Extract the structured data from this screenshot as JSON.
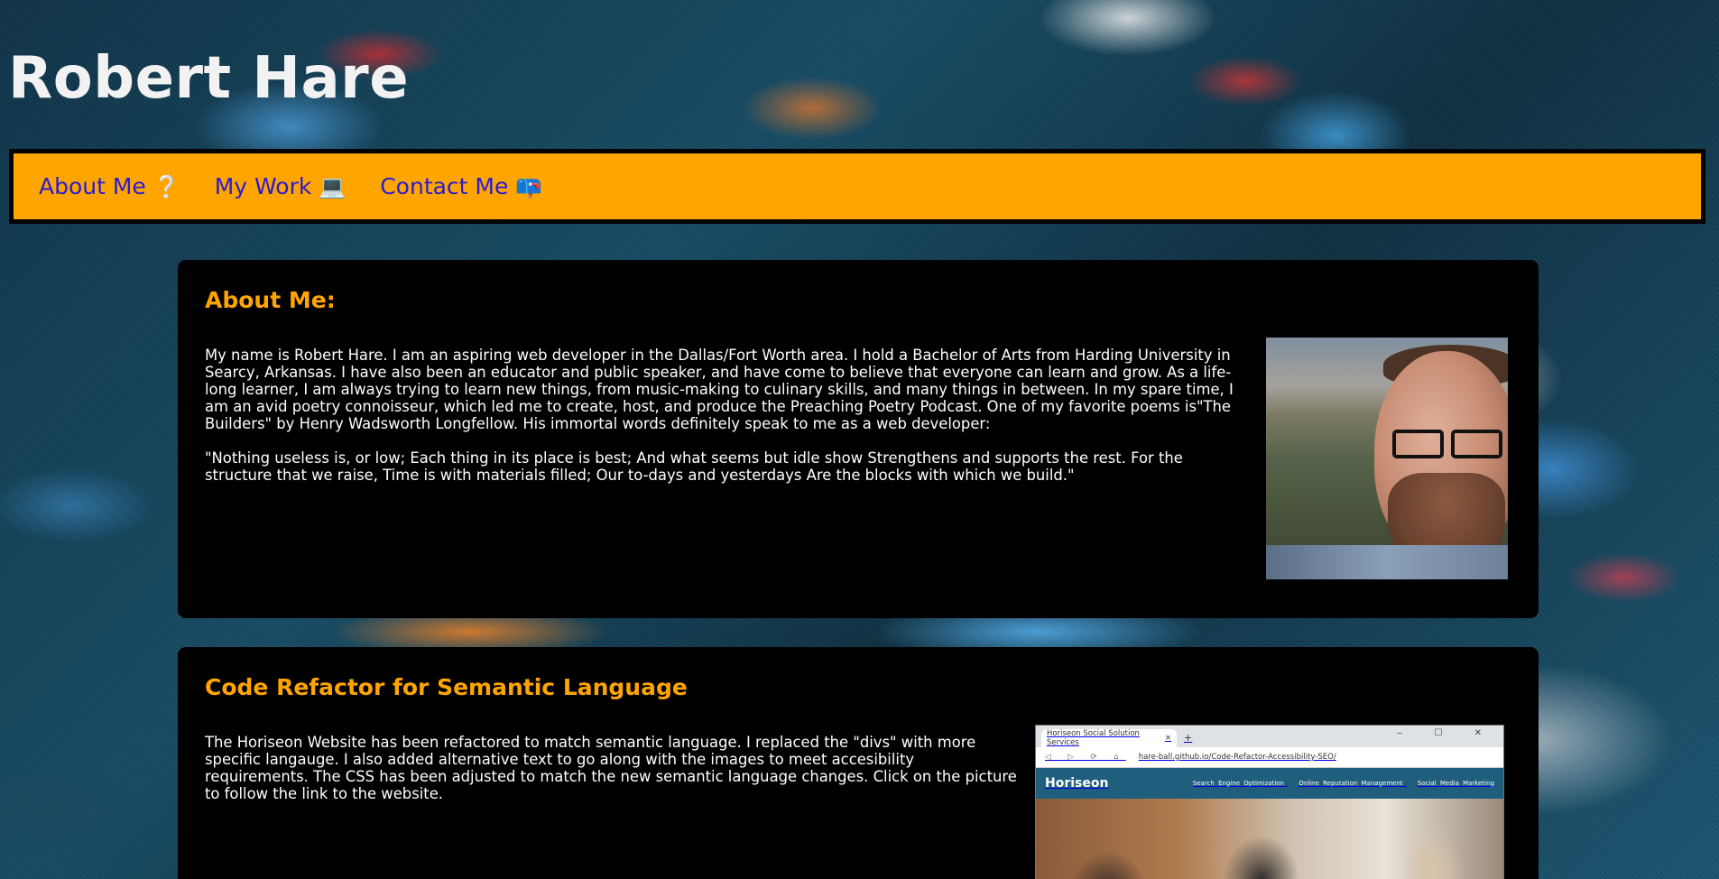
{
  "header": {
    "title": "Robert Hare"
  },
  "nav": {
    "items": [
      {
        "label": "About Me",
        "emoji": "❔"
      },
      {
        "label": "My Work",
        "emoji": "💻"
      },
      {
        "label": "Contact Me",
        "emoji": "📪"
      }
    ]
  },
  "about": {
    "heading": "About Me:",
    "paragraph1": "My name is Robert Hare. I am an aspiring web developer in the Dallas/Fort Worth area. I hold a Bachelor of Arts from Harding University in Searcy, Arkansas. I have also been an educator and public speaker, and have come to believe that everyone can learn and grow. As a life-long learner, I am always trying to learn new things, from music-making to culinary skills, and many things in between. In my spare time, I am an avid poetry connoisseur, which led me to create, host, and produce the Preaching Poetry Podcast. One of my favorite poems is\"The Builders\" by Henry Wadsworth Longfellow. His immortal words definitely speak to me as a web developer:",
    "paragraph2": "\"Nothing useless is, or low; Each thing in its place is best; And what seems but idle show Strengthens and supports the rest. For the structure that we raise, Time is with materials filled; Our to-days and yesterdays Are the blocks with which we build.\""
  },
  "work": {
    "heading": "Code Refactor for Semantic Language",
    "paragraph": "The Horiseon Website has been refactored to match semantic language. I replaced the \"divs\" with more specific langauge. I also added alternative text to go along with the images to meet accesibility requirements. The CSS has been adjusted to match the new semantic language changes. Click on the picture to follow the link to the website.",
    "screenshot": {
      "tab_title": "Horiseon Social Solution Services",
      "tab_close": "×",
      "new_tab": "+",
      "window_controls": "‒ ☐ ✕",
      "nav_buttons": "◁ ▷ ⟳ ⌂",
      "url": "hare-ball.github.io/Code-Refactor-Accessibility-SEO/",
      "brand": "Horiseon",
      "links": [
        "Search Engine Optimization",
        "Online Reputation Management",
        "Social Media Marketing"
      ]
    }
  },
  "colors": {
    "accent": "#ffa500",
    "nav_link": "#2a1ad6",
    "card_bg": "#000000",
    "title": "#f2f2f2"
  }
}
